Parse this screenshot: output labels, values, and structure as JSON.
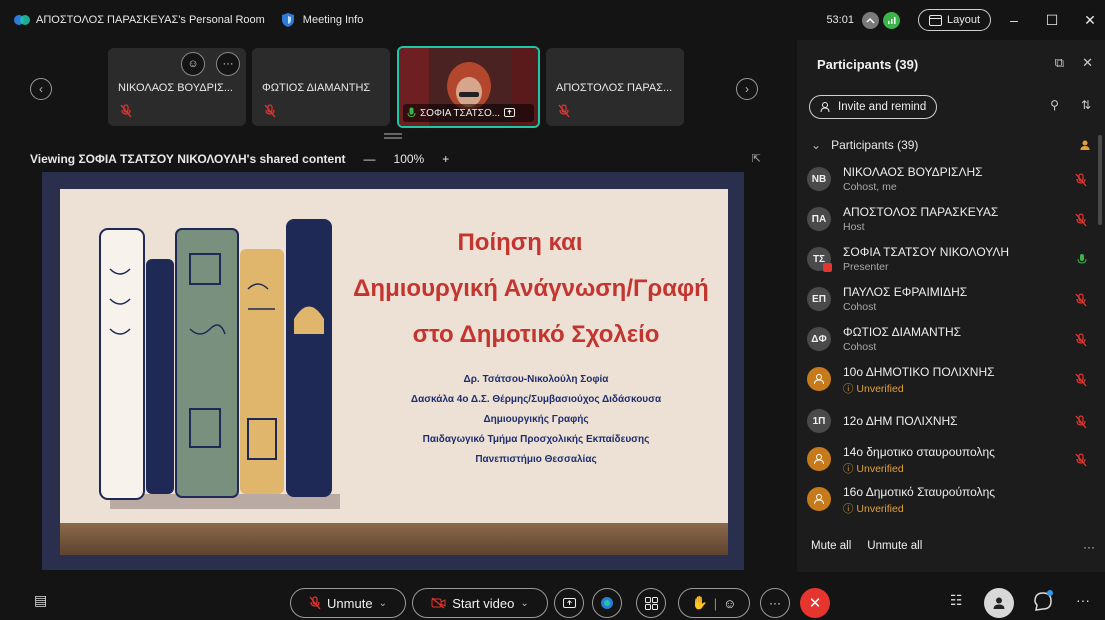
{
  "titlebar": {
    "room_title": "ΑΠΟΣΤΟΛΟΣ ΠΑΡΑΣΚΕΥΑΣ's Personal Room",
    "meeting_info": "Meeting Info",
    "timer": "53:01",
    "layout_label": "Layout"
  },
  "strip": {
    "tiles": [
      {
        "name": "ΝΙΚΟΛΑΟΣ ΒΟΥΔΡΙΣ..."
      },
      {
        "name": "ΦΩΤΙΟΣ ΔΙΑΜΑΝΤΗΣ"
      },
      {
        "name": "ΣΟΦΙΑ ΤΣΑΤΣΟ..."
      },
      {
        "name": "ΑΠΟΣΤΟΛΟΣ ΠΑΡΑΣ..."
      }
    ]
  },
  "share": {
    "title": "Viewing ΣΟΦΙΑ ΤΣΑΤΣΟΥ ΝΙΚΟΛΟΥΛΗ's shared content",
    "zoom_out": "—",
    "zoom": "100%",
    "zoom_in": "+"
  },
  "slide": {
    "title_lines": [
      "Ποίηση και",
      "Δημιουργική Ανάγνωση/Γραφή",
      "στο Δημοτικό Σχολείο"
    ],
    "subtitle_lines": [
      "Δρ. Τσάτσου-Νικολούλη Σοφία",
      "Δασκάλα 4ο Δ.Σ. Θέρμης/Συμβασιούχος Διδάσκουσα",
      "Δημιουργικής Γραφής",
      "Παιδαγωγικό Τμήμα Προσχολικής Εκπαίδευσης",
      "Πανεπιστήμιο Θεσσαλίας"
    ]
  },
  "panel": {
    "title": "Participants (39)",
    "invite_label": "Invite and remind",
    "group_label": "Participants (39)",
    "participants": [
      {
        "initials": "NB",
        "name": "ΝΙΚΟΛΑΟΣ ΒΟΥΔΡΙΣΛΗΣ",
        "role": "Cohost, me"
      },
      {
        "initials": "ΠΑ",
        "name": "ΑΠΟΣΤΟΛΟΣ ΠΑΡΑΣΚΕΥΑΣ",
        "role": "Host"
      },
      {
        "initials": "ΤΣ",
        "name": "ΣΟΦΙΑ ΤΣΑΤΣΟΥ ΝΙΚΟΛΟΥΛΗ",
        "role": "Presenter"
      },
      {
        "initials": "ΕΠ",
        "name": "ΠΑΥΛΟΣ ΕΦΡΑΙΜΙΔΗΣ",
        "role": "Cohost"
      },
      {
        "initials": "ΔΦ",
        "name": "ΦΩΤΙΟΣ ΔΙΑΜΑΝΤΗΣ",
        "role": "Cohost"
      },
      {
        "initials": "",
        "name": "10ο ΔΗΜΟΤΙΚΟ ΠΟΛΙΧΝΗΣ",
        "role": "Unverified"
      },
      {
        "initials": "1Π",
        "name": "12ο ΔΗΜ ΠΟΛΙΧΝΗΣ",
        "role": ""
      },
      {
        "initials": "",
        "name": "14ο  δημοτικο σταυρουπολης",
        "role": "Unverified"
      },
      {
        "initials": "",
        "name": "16ο Δημοτικό Σταυρούπολης",
        "role": "Unverified"
      }
    ],
    "mute_all": "Mute all",
    "unmute_all": "Unmute all"
  },
  "toolbar": {
    "unmute_label": "Unmute",
    "start_video_label": "Start video"
  },
  "colors": {
    "accent_teal": "#1ec7a6",
    "muted_red": "#e6352f",
    "unmuted_green": "#3bb54a",
    "unverified_orange": "#e3a13a"
  }
}
